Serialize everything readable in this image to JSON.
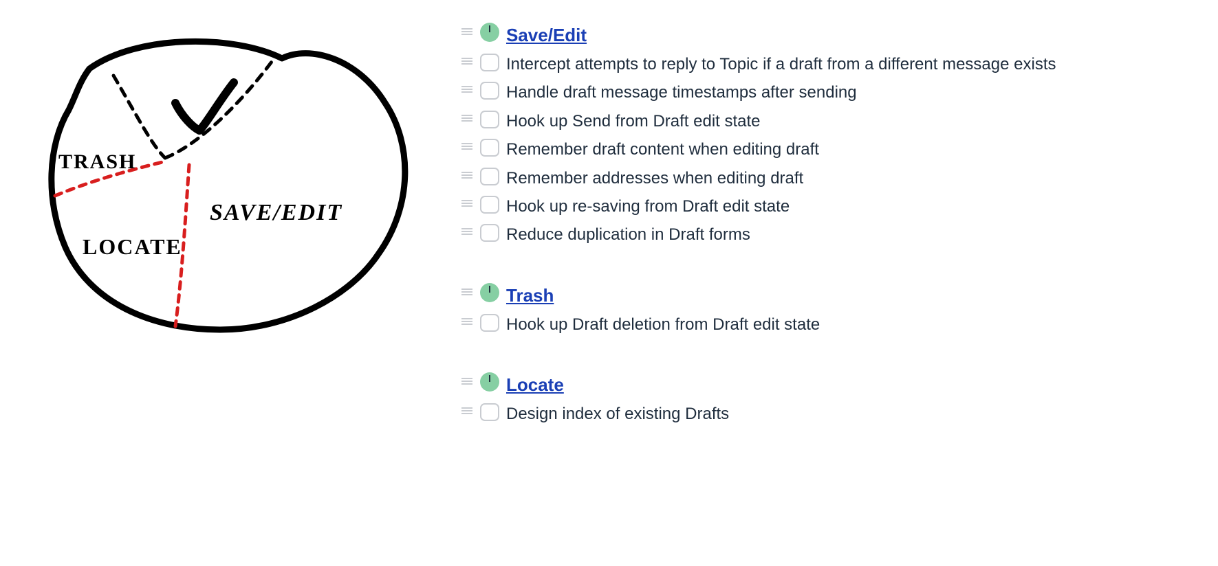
{
  "sketch": {
    "labels": {
      "trash": "TRASH",
      "locate": "LOCATE",
      "save_edit": "SAVE/EDIT"
    }
  },
  "groups": [
    {
      "heading": "Save/Edit",
      "items": [
        "Intercept attempts to reply to Topic if a draft from a different message exists",
        "Handle draft message timestamps after sending",
        "Hook up Send from Draft edit state",
        "Remember draft content when editing draft",
        "Remember addresses when editing draft",
        "Hook up re-saving from Draft edit state",
        "Reduce duplication in Draft forms"
      ]
    },
    {
      "heading": "Trash",
      "items": [
        "Hook up Draft deletion from Draft edit state"
      ]
    },
    {
      "heading": "Locate",
      "items": [
        "Design index of existing Drafts"
      ]
    }
  ]
}
